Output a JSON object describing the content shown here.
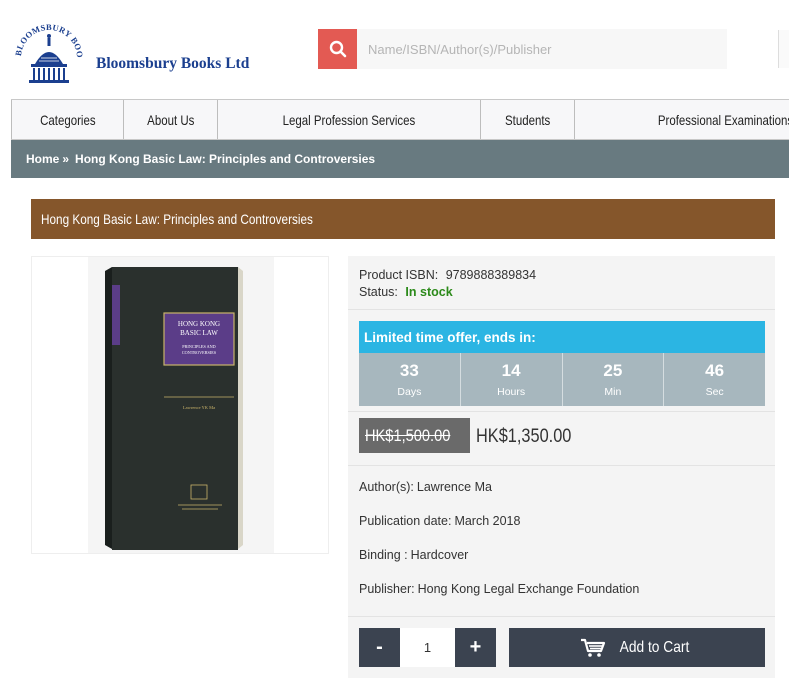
{
  "header": {
    "logo_name": "Bloomsbury Books Ltd",
    "logo_seal_text": "BLOOMSBURY BOOKS LIMITED",
    "search_placeholder": "Name/ISBN/Author(s)/Publisher",
    "search_icon": "search-icon"
  },
  "nav": {
    "items": [
      {
        "label": "Categories"
      },
      {
        "label": "About Us"
      },
      {
        "label": "Legal Profession Services"
      },
      {
        "label": "Students"
      },
      {
        "label": "Professional Examinations"
      }
    ]
  },
  "breadcrumb": {
    "home": "Home",
    "separator": "»",
    "current": "Hong Kong Basic Law: Principles and Controversies"
  },
  "product": {
    "title": "Hong Kong Basic Law: Principles and Controversies",
    "isbn_label": "Product ISBN:",
    "isbn": "9789888389834",
    "status_label": "Status:",
    "status": "In stock",
    "offer_heading": "Limited time offer, ends in:",
    "countdown": [
      {
        "value": "33",
        "unit": "Days"
      },
      {
        "value": "14",
        "unit": "Hours"
      },
      {
        "value": "25",
        "unit": "Min"
      },
      {
        "value": "46",
        "unit": "Sec"
      }
    ],
    "old_price": "HK$1,500.00",
    "new_price": "HK$1,350.00",
    "author_label": "Author(s):",
    "author": "Lawrence Ma",
    "pubdate_label": "Publication date:",
    "pubdate": "March 2018",
    "binding_label": "Binding :",
    "binding": "Hardcover",
    "publisher_label": "Publisher:",
    "publisher": "Hong Kong Legal Exchange Foundation",
    "book_cover": {
      "title_line1": "HONG KONG",
      "title_line2": "BASIC LAW",
      "subtitle_line1": "PRINCIPLES AND",
      "subtitle_line2": "CONTROVERSIES",
      "author": "Lawrence YK Ma"
    }
  },
  "cart": {
    "minus": "-",
    "plus": "+",
    "quantity": "1",
    "add_label": "Add to Cart",
    "cart_icon": "cart-icon"
  },
  "colors": {
    "search_button": "#e35a53",
    "breadcrumb_bar": "#687a80",
    "title_bar": "#85562b",
    "offer_heading": "#2bb5e3",
    "countdown": "#a7b7be",
    "in_stock": "#2c8a1a",
    "cart_buttons": "#3b4350",
    "logo_text": "#1b3f8f"
  }
}
